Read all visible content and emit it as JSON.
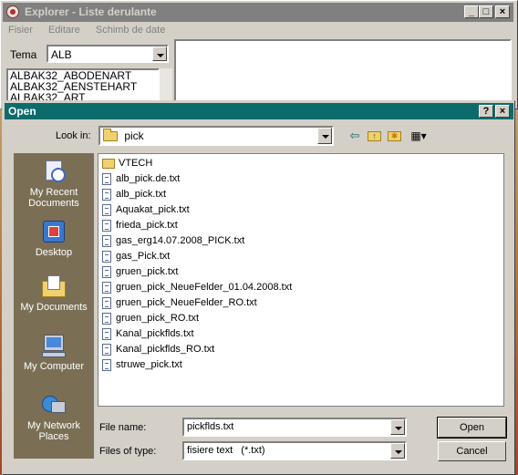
{
  "background_window": {
    "title": "Explorer - Liste derulante",
    "controls": [
      "_",
      "□",
      "×"
    ],
    "menu": [
      "Fisier",
      "Editare",
      "Schimb de date"
    ],
    "tema_label": "Tema",
    "tema_value": "ALB",
    "list_items": [
      "ALBAK32_ABODENART",
      "ALBAK32_AENSTEHART",
      "ALBAK32_ART"
    ]
  },
  "dialog": {
    "title": "Open",
    "help_button": "?",
    "close_button": "×",
    "look_in_label": "Look in:",
    "look_in_value": "pick",
    "toolbar_icons": [
      "back-icon",
      "up-folder-icon",
      "new-folder-icon",
      "view-menu-icon"
    ],
    "places": [
      {
        "label": "My Recent Documents",
        "icon": "recent-documents-icon"
      },
      {
        "label": "Desktop",
        "icon": "desktop-icon"
      },
      {
        "label": "My Documents",
        "icon": "my-documents-icon"
      },
      {
        "label": "My Computer",
        "icon": "my-computer-icon"
      },
      {
        "label": "My Network Places",
        "icon": "network-places-icon"
      }
    ],
    "files": [
      {
        "name": "VTECH",
        "type": "folder"
      },
      {
        "name": "alb_pick.de.txt",
        "type": "file"
      },
      {
        "name": "alb_pick.txt",
        "type": "file"
      },
      {
        "name": "Aquakat_pick.txt",
        "type": "file"
      },
      {
        "name": "frieda_pick.txt",
        "type": "file"
      },
      {
        "name": "gas_erg14.07.2008_PICK.txt",
        "type": "file"
      },
      {
        "name": "gas_Pick.txt",
        "type": "file"
      },
      {
        "name": "gruen_pick.txt",
        "type": "file"
      },
      {
        "name": "gruen_pick_NeueFelder_01.04.2008.txt",
        "type": "file"
      },
      {
        "name": "gruen_pick_NeueFelder_RO.txt",
        "type": "file"
      },
      {
        "name": "gruen_pick_RO.txt",
        "type": "file"
      },
      {
        "name": "Kanal_pickflds.txt",
        "type": "file"
      },
      {
        "name": "Kanal_pickflds_RO.txt",
        "type": "file"
      },
      {
        "name": "struwe_pick.txt",
        "type": "file"
      }
    ],
    "file_name_label": "File name:",
    "file_name_value": "pickflds.txt",
    "files_of_type_label": "Files of type:",
    "files_of_type_value": "fisiere text   (*.txt)",
    "open_button": "Open",
    "cancel_button": "Cancel"
  }
}
